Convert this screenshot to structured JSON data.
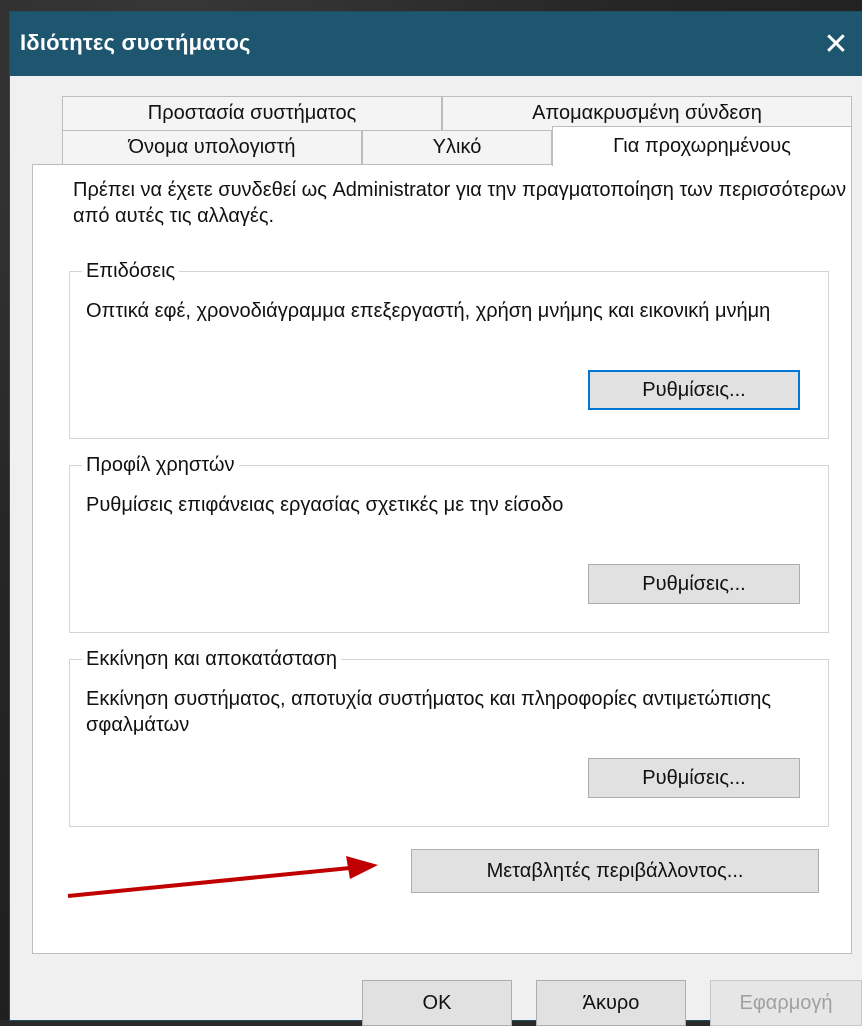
{
  "window": {
    "title": "Ιδιότητες συστήματος",
    "close_symbol": "✕"
  },
  "tabs": {
    "top": [
      {
        "label": "Προστασία συστήματος"
      },
      {
        "label": "Απομακρυσμένη σύνδεση"
      }
    ],
    "bottom": [
      {
        "label": "Όνομα υπολογιστή"
      },
      {
        "label": "Υλικό"
      },
      {
        "label": "Για προχωρημένους",
        "selected": true
      }
    ]
  },
  "panel": {
    "intro": "Πρέπει να έχετε συνδεθεί ως Administrator για την πραγματοποίηση των περισσότερων από αυτές τις αλλαγές.",
    "groups": [
      {
        "title": "Επιδόσεις",
        "description": "Οπτικά εφέ, χρονοδιάγραμμα επεξεργαστή, χρήση μνήμης και εικονική μνήμη",
        "button_label": "Ρυθμίσεις..."
      },
      {
        "title": "Προφίλ χρηστών",
        "description": "Ρυθμίσεις επιφάνειας εργασίας σχετικές με την είσοδο",
        "button_label": "Ρυθμίσεις..."
      },
      {
        "title": "Εκκίνηση και αποκατάσταση",
        "description": "Εκκίνηση συστήματος, αποτυχία συστήματος και πληροφορίες αντιμετώπισης σφαλμάτων",
        "button_label": "Ρυθμίσεις..."
      }
    ],
    "env_button_label": "Μεταβλητές περιβάλλοντος..."
  },
  "footer": {
    "ok_label": "OK",
    "cancel_label": "Άκυρο",
    "apply_label": "Εφαρμογή"
  },
  "colors": {
    "titlebar": "#1e5670",
    "focus": "#0078d7",
    "arrow": "#c00000"
  },
  "icons": {
    "close": "close-icon",
    "annotation": "red-arrow-icon"
  }
}
